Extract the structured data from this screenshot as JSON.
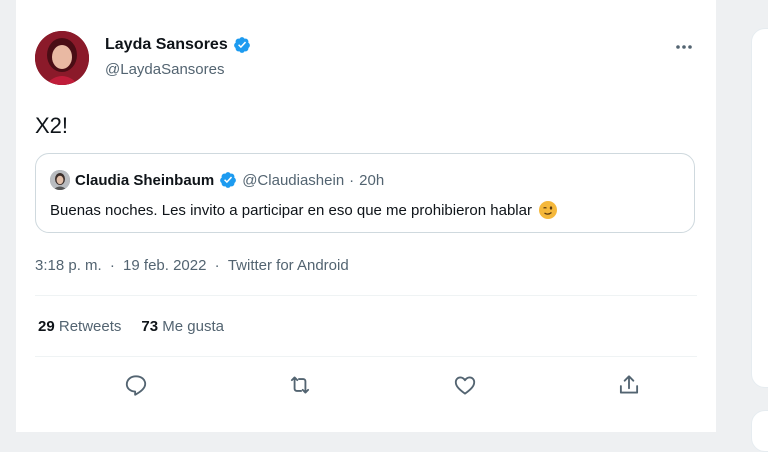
{
  "author": {
    "name": "Layda Sansores",
    "handle": "@LaydaSansores"
  },
  "tweet_text": "X2!",
  "quoted": {
    "name": "Claudia Sheinbaum",
    "handle": "@Claudiashein",
    "separator": "·",
    "age": "20h",
    "text": "Buenas noches. Les invito a participar en eso que me prohibieron hablar"
  },
  "meta": {
    "time": "3:18 p. m.",
    "date": "19 feb. 2022",
    "source": "Twitter for Android",
    "separator": "·"
  },
  "stats": {
    "retweets_count": "29",
    "retweets_label": "Retweets",
    "likes_count": "73",
    "likes_label": "Me gusta"
  },
  "colors": {
    "verified": "#1d9bf0",
    "text_primary": "#0f1419",
    "text_secondary": "#536471",
    "border": "#cfd9de"
  },
  "icons": {
    "more": "more-horizontal-icon",
    "reply": "reply-icon",
    "retweet": "retweet-icon",
    "like": "like-icon",
    "share": "share-icon"
  }
}
